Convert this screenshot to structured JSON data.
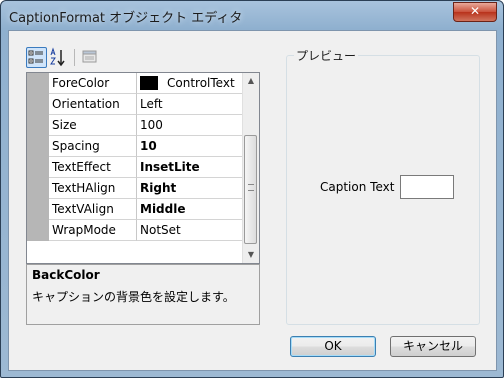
{
  "window": {
    "title": "CaptionFormat オブジェクト エディタ",
    "close_glyph": "✕"
  },
  "toolbar": {
    "buttons": [
      "categorized-icon",
      "sort-alphabetical-icon",
      "property-pages-icon"
    ]
  },
  "properties": [
    {
      "name": "ForeColor",
      "value": "ControlText",
      "bold": false,
      "swatch": "#000000"
    },
    {
      "name": "Orientation",
      "value": "Left",
      "bold": false
    },
    {
      "name": "Size",
      "value": "100",
      "bold": false
    },
    {
      "name": "Spacing",
      "value": "10",
      "bold": true
    },
    {
      "name": "TextEffect",
      "value": "InsetLite",
      "bold": true
    },
    {
      "name": "TextHAlign",
      "value": "Right",
      "bold": true
    },
    {
      "name": "TextVAlign",
      "value": "Middle",
      "bold": true
    },
    {
      "name": "WrapMode",
      "value": "NotSet",
      "bold": false
    }
  ],
  "help": {
    "title": "BackColor",
    "description": "キャプションの背景色を設定します。"
  },
  "preview": {
    "legend": "プレビュー",
    "caption_label": "Caption Text",
    "text_value": ""
  },
  "buttons": {
    "ok": "OK",
    "cancel": "キャンセル"
  },
  "colors": {
    "title_gradient": "#9db9d3",
    "client": "#f0f0f0",
    "grid_margin": "#b6b6b6"
  }
}
